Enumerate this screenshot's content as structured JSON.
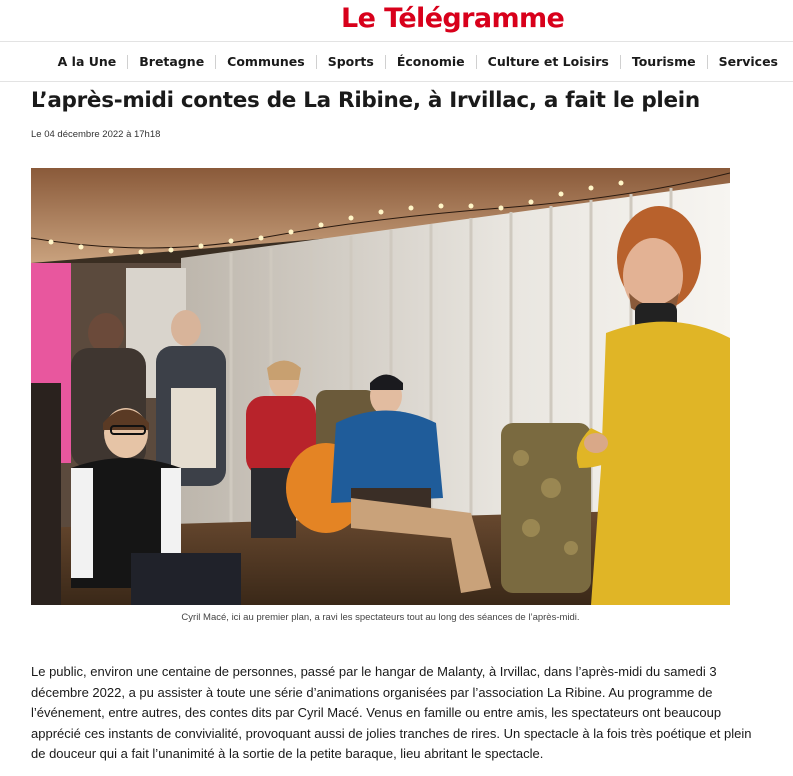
{
  "site": {
    "logo_text": "Le Télégramme",
    "brand_color": "#d8001b"
  },
  "nav": {
    "items": [
      {
        "label": "A la Une"
      },
      {
        "label": "Bretagne"
      },
      {
        "label": "Communes"
      },
      {
        "label": "Sports"
      },
      {
        "label": "Économie"
      },
      {
        "label": "Culture et Loisirs"
      },
      {
        "label": "Tourisme"
      },
      {
        "label": "Services"
      }
    ]
  },
  "article": {
    "title": "L’après-midi contes de La Ribine, à Irvillac, a fait le plein",
    "date": "Le 04 décembre 2022 à 17h18",
    "photo_caption": "Cyril Macé, ici au premier plan, a ravi les spectateurs tout au long des séances de l’après-midi.",
    "body": "Le public, environ une centaine de personnes, passé par le hangar de Malanty, à Irvillac, dans l’après-midi du samedi 3 décembre 2022, a pu assister à toute une série d’animations organisées par l’association La Ribine. Au programme de l’événement, entre autres, des contes dits par Cyril Macé. Venus en famille ou entre amis, les spectateurs ont beaucoup apprécié ces instants de convivialité, provoquant aussi de jolies tranches de rires. Un spectacle à la fois très poétique et plein de douceur qui a fait l’unanimité à la sortie de la petite baraque, lieu abritant le spectacle."
  }
}
